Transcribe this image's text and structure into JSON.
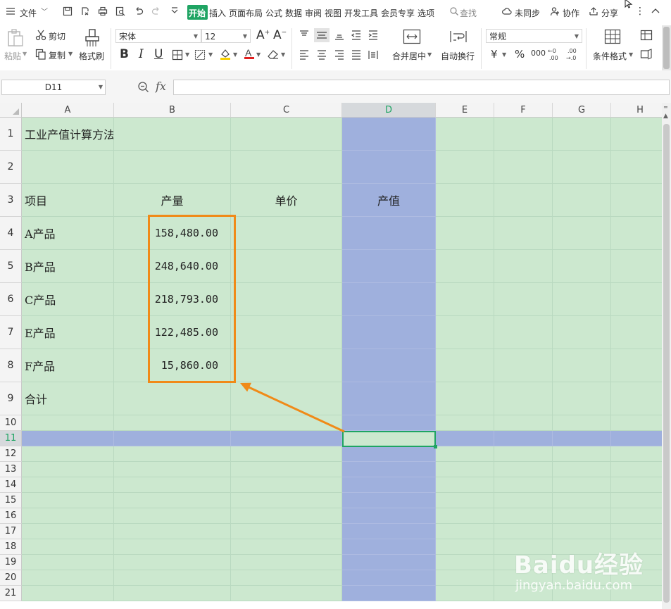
{
  "colors": {
    "accent": "#1fa463",
    "cell_bg": "#cce8cf",
    "highlight": "#9fb0dd",
    "annotation": "#f08a18"
  },
  "menubar": {
    "file": "文件",
    "tabs": [
      "开始",
      "插入",
      "页面布局",
      "公式",
      "数据",
      "审阅",
      "视图",
      "开发工具",
      "会员专享",
      "选项"
    ],
    "search": "查找",
    "sync": "未同步",
    "collab": "协作",
    "share": "分享"
  },
  "ribbon": {
    "paste": "粘贴",
    "cut": "剪切",
    "copy": "复制",
    "format_painter": "格式刷",
    "font_name": "宋体",
    "font_size": "12",
    "bold": "B",
    "italic": "I",
    "underline": "U",
    "merge_center": "合并居中",
    "wrap_text": "自动换行",
    "number_format": "常规",
    "currency": "¥",
    "percent": "%",
    "thousands": "000",
    "cond_format": "条件格式"
  },
  "formula_bar": {
    "name_box": "D11",
    "fx": "fx"
  },
  "sheet": {
    "columns": [
      "A",
      "B",
      "C",
      "D",
      "E",
      "F",
      "G",
      "H"
    ],
    "rows": [
      "1",
      "2",
      "3",
      "4",
      "5",
      "6",
      "7",
      "8",
      "9",
      "10",
      "11",
      "12",
      "13",
      "14",
      "15",
      "16",
      "17",
      "18",
      "19",
      "20",
      "21"
    ],
    "selected_col": "D",
    "selected_row": "11",
    "cells": {
      "A1": "工业产值计算方法",
      "A3": "项目",
      "B3": "产量",
      "C3": "单价",
      "D3": "产值",
      "A4": "A产品",
      "B4": "158,480.00",
      "A5": "B产品",
      "B5": "248,640.00",
      "A6": "C产品",
      "B6": "218,793.00",
      "A7": "E产品",
      "B7": "122,485.00",
      "A8": "F产品",
      "B8": "15,860.00",
      "A9": "合计"
    }
  },
  "watermark": {
    "brand": "Baidu经验",
    "url": "jingyan.baidu.com"
  }
}
